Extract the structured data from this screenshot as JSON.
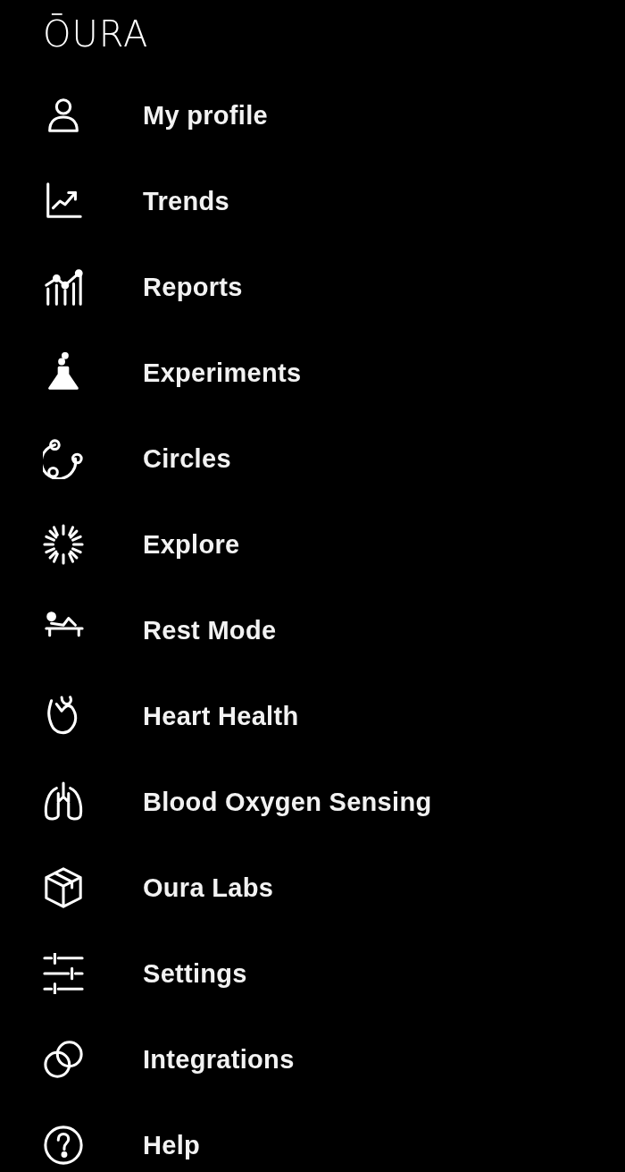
{
  "logo": "ŌURA",
  "menu": [
    {
      "label": "My profile"
    },
    {
      "label": "Trends"
    },
    {
      "label": "Reports"
    },
    {
      "label": "Experiments"
    },
    {
      "label": "Circles"
    },
    {
      "label": "Explore"
    },
    {
      "label": "Rest Mode"
    },
    {
      "label": "Heart Health"
    },
    {
      "label": "Blood Oxygen Sensing"
    },
    {
      "label": "Oura Labs"
    },
    {
      "label": "Settings"
    },
    {
      "label": "Integrations"
    },
    {
      "label": "Help"
    }
  ]
}
